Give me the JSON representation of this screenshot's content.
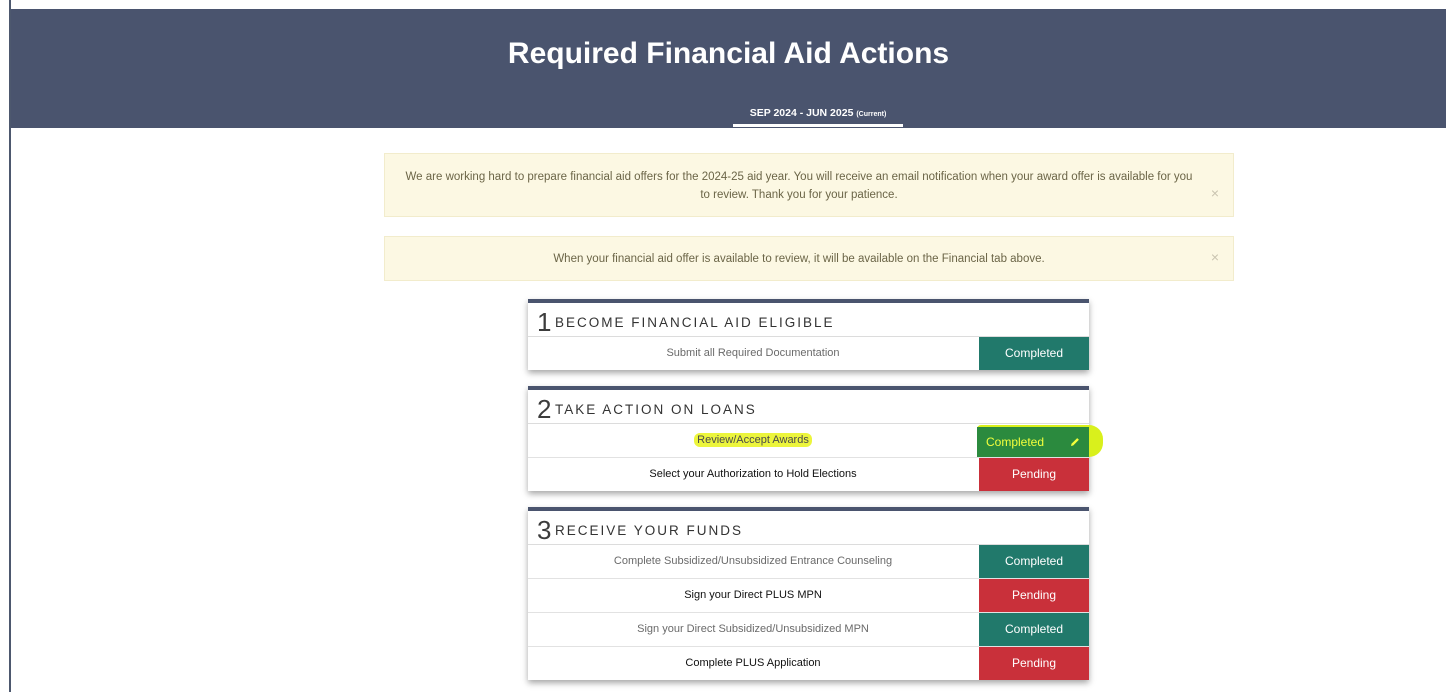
{
  "header": {
    "title": "Required Financial Aid Actions",
    "term_tab": "SEP 2024 - JUN 2025",
    "term_tab_suffix": "(Current)"
  },
  "alerts": [
    {
      "message": "We are working hard to prepare financial aid offers for the 2024-25 aid year. You will receive an email notification when your award offer is available for you to review. Thank you for your patience.",
      "close": "×"
    },
    {
      "message": "When your financial aid offer is available to review, it will be available on the Financial tab above.",
      "close": "×"
    }
  ],
  "sections": [
    {
      "number": "1",
      "title": "BECOME FINANCIAL AID ELIGIBLE",
      "items": [
        {
          "label": "Submit all Required Documentation",
          "status": "Completed"
        }
      ]
    },
    {
      "number": "2",
      "title": "TAKE ACTION ON LOANS",
      "items": [
        {
          "label": "Review/Accept Awards",
          "status": "Completed"
        },
        {
          "label": "Select your Authorization to Hold Elections",
          "status": "Pending"
        }
      ]
    },
    {
      "number": "3",
      "title": "RECEIVE YOUR FUNDS",
      "items": [
        {
          "label": "Complete Subsidized/Unsubsidized Entrance Counseling",
          "status": "Completed"
        },
        {
          "label": "Sign your Direct PLUS MPN",
          "status": "Pending"
        },
        {
          "label": "Sign your Direct Subsidized/Unsubsidized MPN",
          "status": "Completed"
        },
        {
          "label": "Complete PLUS Application",
          "status": "Pending"
        }
      ]
    }
  ],
  "colors": {
    "header_bg": "#4a546e",
    "completed": "#21796b",
    "pending": "#c9303a",
    "alert_bg": "#fcf8e3",
    "highlight": "#ecf53c"
  },
  "icons": {
    "edit": "pencil-icon",
    "close": "close-icon"
  }
}
